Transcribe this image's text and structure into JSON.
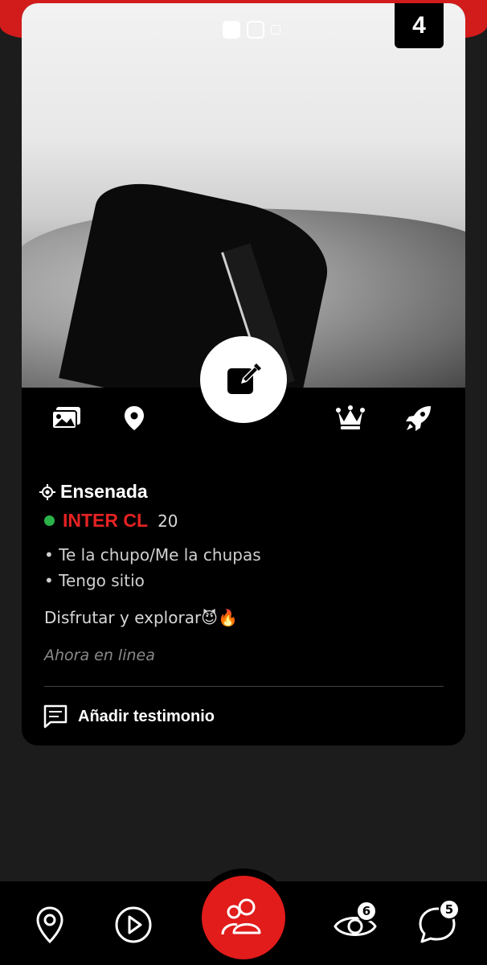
{
  "photo": {
    "count": "4",
    "dots": [
      "active",
      "inactive",
      "small"
    ]
  },
  "actions": {
    "icons": [
      "gallery-icon",
      "location-pin-icon",
      "edit-icon",
      "crown-icon",
      "rocket-icon"
    ]
  },
  "profile": {
    "location": "Ensenada",
    "name": "INTER CL",
    "age": "20",
    "bullets": [
      "Te la chupo/Me la chupas",
      "Tengo sitio"
    ],
    "bio": "Disfrutar y explorar😈🔥",
    "status": "Ahora en linea",
    "testimony_label": "Añadir testimonio",
    "online_color": "#2bb34a",
    "name_color": "#e52222"
  },
  "nav": {
    "views_badge": "6",
    "messages_badge": "5",
    "icons": [
      "map-pin-icon",
      "play-icon",
      "people-icon",
      "eye-icon",
      "chat-bubble-icon"
    ],
    "accent": "#e21b1b"
  }
}
